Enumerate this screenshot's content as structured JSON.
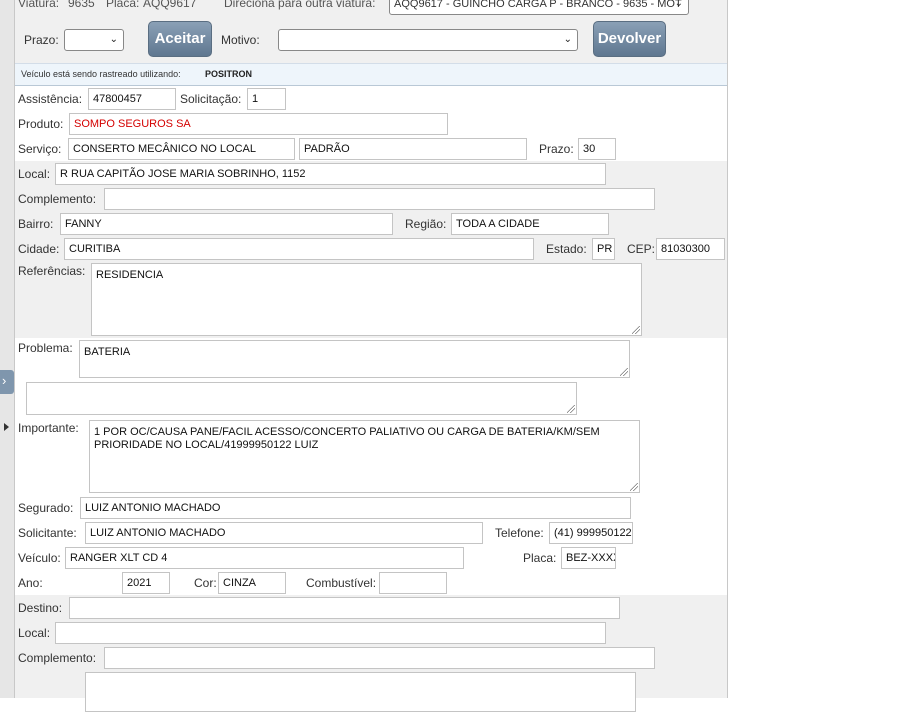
{
  "header": {
    "viatura_label": "Viatura:",
    "viatura_value": "9635",
    "placa_label": "Placa:",
    "placa_value": "AQQ9617",
    "direciona_label": "Direciona para outra viatura:",
    "direciona_selected": "AQQ9617 - GUINCHO CARGA P - BRANCO - 9635 - MOT",
    "prazo_label": "Prazo:",
    "prazo_selected": "",
    "aceitar_label": "Aceitar",
    "motivo_label": "Motivo:",
    "motivo_selected": "",
    "devolver_label": "Devolver"
  },
  "tracking": {
    "text": "Veículo está sendo rastreado utilizando:",
    "provider": "POSITRON"
  },
  "form": {
    "assistencia_label": "Assistência:",
    "assistencia": "47800457",
    "solicitacao_label": "Solicitação:",
    "solicitacao": "1",
    "produto_label": "Produto:",
    "produto": "SOMPO SEGUROS SA",
    "servico_label": "Serviço:",
    "servico": "CONSERTO MECÂNICO NO LOCAL",
    "servico_tipo": "PADRÃO",
    "prazo_label": "Prazo:",
    "prazo": "30",
    "local_label": "Local:",
    "local": "R RUA CAPITÃO JOSE MARIA SOBRINHO, 1152",
    "complemento_label": "Complemento:",
    "complemento": "",
    "bairro_label": "Bairro:",
    "bairro": "FANNY",
    "regiao_label": "Região:",
    "regiao": "TODA A CIDADE",
    "cidade_label": "Cidade:",
    "cidade": "CURITIBA",
    "estado_label": "Estado:",
    "estado": "PR",
    "cep_label": "CEP:",
    "cep": "81030300",
    "referencias_label": "Referências:",
    "referencias": "RESIDENCIA",
    "problema_label": "Problema:",
    "problema": "BATERIA",
    "problema_extra": "",
    "importante_label": "Importante:",
    "importante": "1 POR OC/CAUSA PANE/FACIL ACESSO/CONCERTO PALIATIVO OU CARGA DE BATERIA/KM/SEM PRIORIDADE NO LOCAL/41999950122 LUIZ",
    "segurado_label": "Segurado:",
    "segurado": "LUIZ ANTONIO MACHADO",
    "solicitante_label": "Solicitante:",
    "solicitante": "LUIZ ANTONIO MACHADO",
    "telefone_label": "Telefone:",
    "telefone": "(41) 999950122",
    "veiculo_label": "Veículo:",
    "veiculo": "RANGER XLT CD 4",
    "placa_label": "Placa:",
    "placa": "BEZ-XXXX",
    "ano_label": "Ano:",
    "ano": "2021",
    "cor_label": "Cor:",
    "cor": "CINZA",
    "combustivel_label": "Combustível:",
    "combustivel": "",
    "destino_label": "Destino:",
    "destino": "",
    "destino_local_label": "Local:",
    "destino_local": "",
    "destino_complemento_label": "Complemento:",
    "destino_complemento": ""
  },
  "icons": {
    "side_toggle": "chevron-right-icon",
    "side_marker": "triangle-right-icon"
  }
}
